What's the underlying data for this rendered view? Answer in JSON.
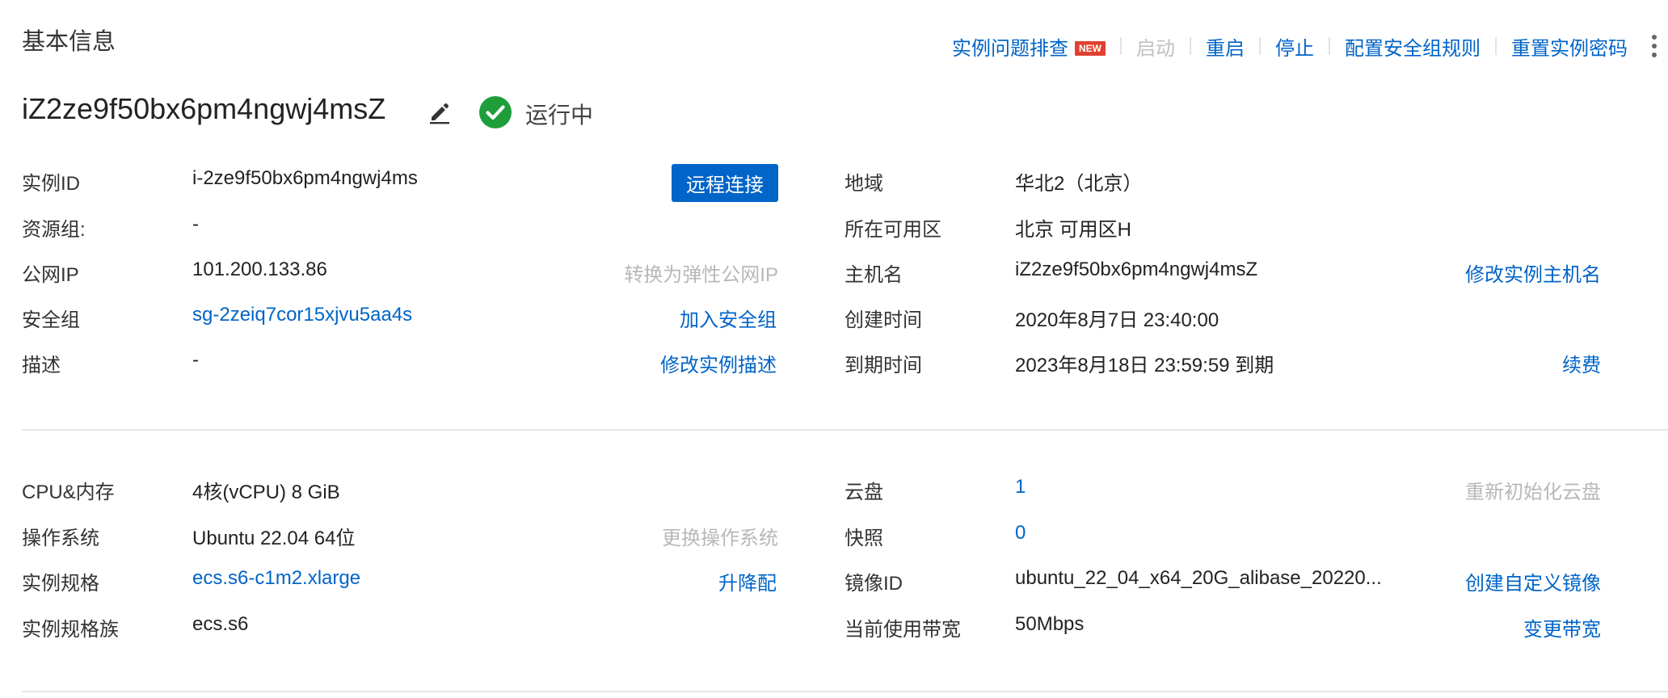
{
  "section_title": "基本信息",
  "actions": {
    "troubleshoot": "实例问题排查",
    "new_badge": "NEW",
    "start": "启动",
    "restart": "重启",
    "stop": "停止",
    "security_rules": "配置安全组规则",
    "reset_password": "重置实例密码"
  },
  "instance": {
    "name": "iZ2ze9f50bx6pm4ngwj4msZ",
    "status": "运行中",
    "status_color": "#1e9e3b"
  },
  "left_rows": [
    {
      "label": "实例ID",
      "value": "i-2ze9f50bx6pm4ngwj4ms",
      "action": "远程连接"
    },
    {
      "label": "资源组:",
      "value": "-"
    },
    {
      "label": "公网IP",
      "value": "101.200.133.86",
      "action": "转换为弹性公网IP"
    },
    {
      "label": "安全组",
      "value": "sg-2zeiq7cor15xjvu5aa4s",
      "action": "加入安全组"
    },
    {
      "label": "描述",
      "value": "-",
      "action": "修改实例描述"
    }
  ],
  "right_rows": [
    {
      "label": "地域",
      "value": "华北2（北京）"
    },
    {
      "label": "所在可用区",
      "value": "北京 可用区H"
    },
    {
      "label": "主机名",
      "value": "iZ2ze9f50bx6pm4ngwj4msZ",
      "action": "修改实例主机名"
    },
    {
      "label": "创建时间",
      "value": "2020年8月7日 23:40:00"
    },
    {
      "label": "到期时间",
      "value": "2023年8月18日 23:59:59 到期",
      "action": "续费"
    }
  ],
  "left_rows2": [
    {
      "label": "CPU&内存",
      "value": "4核(vCPU) 8 GiB"
    },
    {
      "label": "操作系统",
      "value": "Ubuntu 22.04 64位",
      "action": "更换操作系统"
    },
    {
      "label": "实例规格",
      "value": "ecs.s6-c1m2.xlarge",
      "action": "升降配"
    },
    {
      "label": "实例规格族",
      "value": "ecs.s6"
    }
  ],
  "right_rows2": [
    {
      "label": "云盘",
      "value": "1",
      "action": "重新初始化云盘"
    },
    {
      "label": "快照",
      "value": "0"
    },
    {
      "label": "镜像ID",
      "value": "ubuntu_22_04_x64_20G_alibase_20220...",
      "action": "创建自定义镜像"
    },
    {
      "label": "当前使用带宽",
      "value": "50Mbps",
      "action": "变更带宽"
    }
  ]
}
